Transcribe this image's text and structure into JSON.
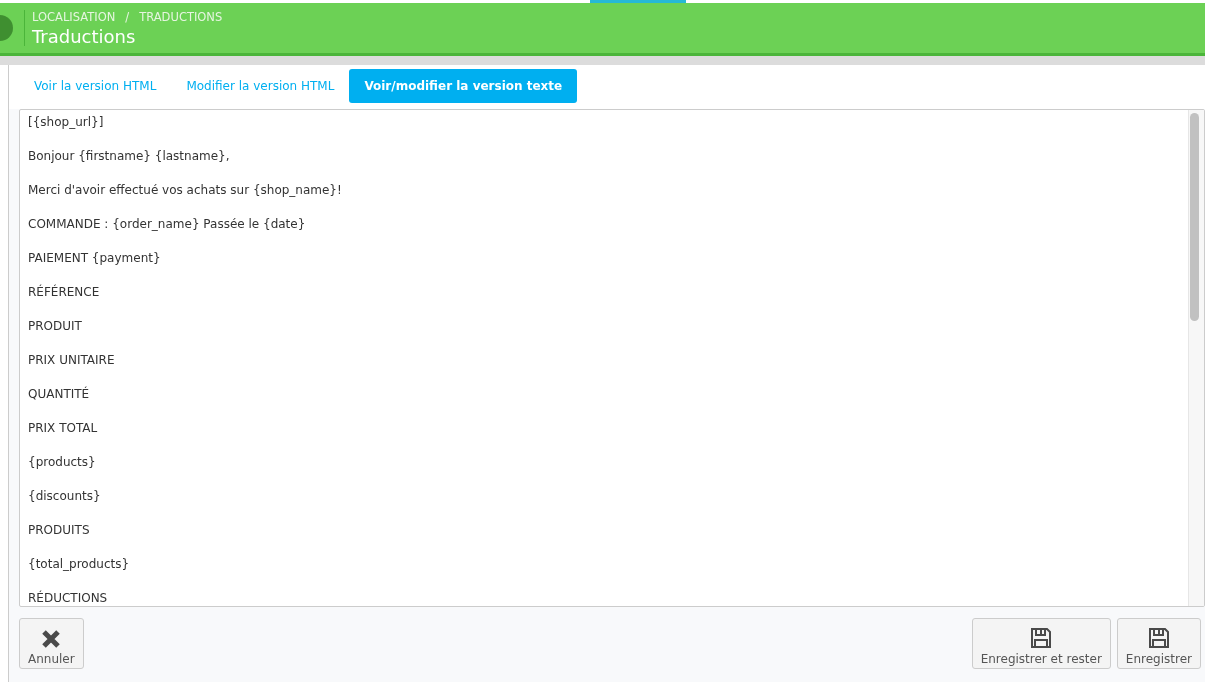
{
  "header": {
    "breadcrumb": [
      "LOCALISATION",
      "TRADUCTIONS"
    ],
    "separator": "/",
    "title": "Traductions"
  },
  "tabs": [
    {
      "label": "Voir la version HTML",
      "selected": false
    },
    {
      "label": "Modifier la version HTML",
      "selected": false
    },
    {
      "label": "Voir/modifier la version texte",
      "selected": true
    }
  ],
  "editor": {
    "lines": [
      "[{shop_url}]",
      "Bonjour {firstname} {lastname},",
      "Merci d'avoir effectué vos achats sur {shop_name}!",
      "COMMANDE : {order_name} Passée le {date}",
      "PAIEMENT {payment}",
      "RÉFÉRENCE",
      "PRODUIT",
      "PRIX UNITAIRE",
      "QUANTITÉ",
      "PRIX TOTAL",
      "{products}",
      "{discounts}",
      "PRODUITS",
      "{total_products}",
      "RÉDUCTIONS"
    ]
  },
  "footer": {
    "buttons": [
      {
        "kind": "cancel",
        "label": "Annuler"
      },
      {
        "kind": "save",
        "label": "Enregistrer et rester"
      },
      {
        "kind": "save",
        "label": "Enregistrer"
      }
    ]
  }
}
